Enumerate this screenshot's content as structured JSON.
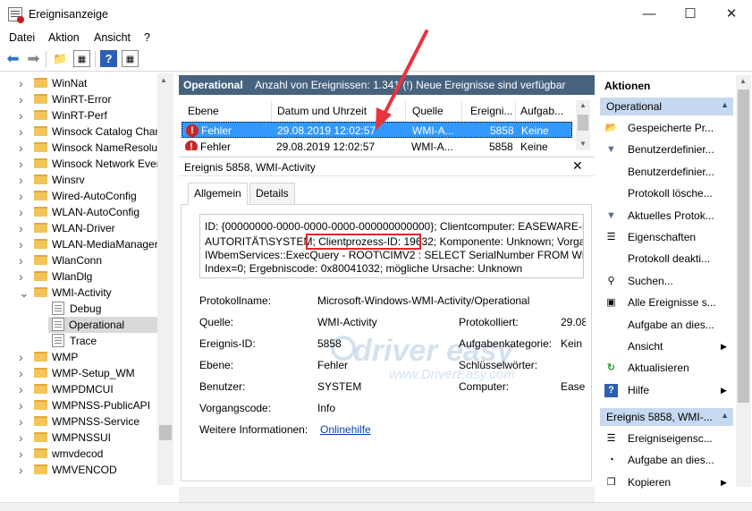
{
  "window": {
    "title": "Ereignisanzeige"
  },
  "menu": [
    "Datei",
    "Aktion",
    "Ansicht",
    "?"
  ],
  "tree": [
    {
      "label": "WinNat",
      "kind": "folder",
      "expanded": false
    },
    {
      "label": "WinRT-Error",
      "kind": "folder",
      "expanded": false
    },
    {
      "label": "WinRT-Perf",
      "kind": "folder",
      "expanded": false
    },
    {
      "label": "Winsock Catalog Chan",
      "kind": "folder",
      "expanded": false
    },
    {
      "label": "Winsock NameResolut",
      "kind": "folder",
      "expanded": false
    },
    {
      "label": "Winsock Network Ever",
      "kind": "folder",
      "expanded": false
    },
    {
      "label": "Winsrv",
      "kind": "folder",
      "expanded": false
    },
    {
      "label": "Wired-AutoConfig",
      "kind": "folder",
      "expanded": false
    },
    {
      "label": "WLAN-AutoConfig",
      "kind": "folder",
      "expanded": false
    },
    {
      "label": "WLAN-Driver",
      "kind": "folder",
      "expanded": false
    },
    {
      "label": "WLAN-MediaManager",
      "kind": "folder",
      "expanded": false
    },
    {
      "label": "WlanConn",
      "kind": "folder",
      "expanded": false
    },
    {
      "label": "WlanDlg",
      "kind": "folder",
      "expanded": false
    },
    {
      "label": "WMI-Activity",
      "kind": "folder",
      "expanded": true
    },
    {
      "label": "Debug",
      "kind": "log",
      "child": true
    },
    {
      "label": "Operational",
      "kind": "log",
      "child": true,
      "selected": true
    },
    {
      "label": "Trace",
      "kind": "log",
      "child": true
    },
    {
      "label": "WMP",
      "kind": "folder",
      "expanded": false
    },
    {
      "label": "WMP-Setup_WM",
      "kind": "folder",
      "expanded": false
    },
    {
      "label": "WMPDMCUI",
      "kind": "folder",
      "expanded": false
    },
    {
      "label": "WMPNSS-PublicAPI",
      "kind": "folder",
      "expanded": false
    },
    {
      "label": "WMPNSS-Service",
      "kind": "folder",
      "expanded": false
    },
    {
      "label": "WMPNSSUI",
      "kind": "folder",
      "expanded": false
    },
    {
      "label": "wmvdecod",
      "kind": "folder",
      "expanded": false
    },
    {
      "label": "WMVENCOD",
      "kind": "folder",
      "expanded": false
    }
  ],
  "events": {
    "header_title": "Operational",
    "header_info": "Anzahl von Ereignissen: 1.341 (!) Neue Ereignisse sind verfügbar",
    "columns": [
      "Ebene",
      "Datum und Uhrzeit",
      "Quelle",
      "Ereigni...",
      "Aufgab..."
    ],
    "rows": [
      [
        "Fehler",
        "29.08.2019 12:02:57",
        "WMI-A...",
        "5858",
        "Keine"
      ],
      [
        "Fehler",
        "29.08.2019 12:02:57",
        "WMI-A...",
        "5858",
        "Keine"
      ]
    ]
  },
  "detail": {
    "title": "Ereignis 5858, WMI-Activity",
    "tabs": [
      "Allgemein",
      "Details"
    ],
    "description": [
      "ID: {00000000-0000-0000-0000-000000000000}; Clientcomputer: EASEWARE-DELL",
      "AUTORITÄT\\SYSTEM; ",
      "Clientprozess-ID: 19632",
      "; Komponente: Unknown; Vorgang",
      "IWbemServices::ExecQuery - ROOT\\CIMV2 : SELECT SerialNumber FROM Win32_",
      "Index=0; Ergebniscode: 0x80041032; mögliche Ursache: Unknown"
    ],
    "props": {
      "protokollname_label": "Protokollname:",
      "protokollname": "Microsoft-Windows-WMI-Activity/Operational",
      "quelle_label": "Quelle:",
      "quelle": "WMI-Activity",
      "protokolliert_label": "Protokolliert:",
      "protokolliert": "29.08",
      "ereignis_label": "Ereignis-ID:",
      "ereignis": "5858",
      "kategorie_label": "Aufgabenkategorie:",
      "kategorie": "Kein",
      "ebene_label": "Ebene:",
      "ebene": "Fehler",
      "keywords_label": "Schlüsselwörter:",
      "keywords": "",
      "benutzer_label": "Benutzer:",
      "benutzer": "SYSTEM",
      "computer_label": "Computer:",
      "computer": "Ease",
      "opcode_label": "Vorgangscode:",
      "opcode": "Info",
      "info_label": "Weitere Informationen:",
      "info_link": "Onlinehilfe"
    }
  },
  "watermark": {
    "text": "driver easy",
    "sub": "www.DriverEasy.com"
  },
  "actions": {
    "header": "Aktionen",
    "section1": "Operational",
    "items1": [
      {
        "label": "Gespeicherte Pr...",
        "icon": "folder-open-icon",
        "glyph": "📂"
      },
      {
        "label": "Benutzerdefinier...",
        "icon": "filter-icon",
        "glyph": "▼"
      },
      {
        "label": "Benutzerdefinier...",
        "icon": "",
        "glyph": ""
      },
      {
        "label": "Protokoll lösche...",
        "icon": "",
        "glyph": ""
      },
      {
        "label": "Aktuelles Protok...",
        "icon": "filter-icon",
        "glyph": "▼"
      },
      {
        "label": "Eigenschaften",
        "icon": "properties-icon",
        "glyph": "☰"
      },
      {
        "label": "Protokoll deakti...",
        "icon": "",
        "glyph": ""
      },
      {
        "label": "Suchen...",
        "icon": "binoculars-icon",
        "glyph": "⚲"
      },
      {
        "label": "Alle Ereignisse s...",
        "icon": "save-icon",
        "glyph": "▣"
      },
      {
        "label": "Aufgabe an dies...",
        "icon": "",
        "glyph": ""
      },
      {
        "label": "Ansicht",
        "icon": "",
        "glyph": "",
        "submenu": true
      },
      {
        "label": "Aktualisieren",
        "icon": "refresh-icon",
        "glyph": "↻"
      },
      {
        "label": "Hilfe",
        "icon": "help-icon",
        "glyph": "?",
        "submenu": true
      }
    ],
    "section2": "Ereignis 5858, WMI-...",
    "items2": [
      {
        "label": "Ereigniseigensc...",
        "icon": "properties-icon",
        "glyph": "☰"
      },
      {
        "label": "Aufgabe an dies...",
        "icon": "task-icon",
        "glyph": "◔"
      },
      {
        "label": "Kopieren",
        "icon": "copy-icon",
        "glyph": "❐",
        "submenu": true
      }
    ]
  },
  "colors": {
    "header": "#47627f",
    "selection": "#3399ff",
    "section": "#c6d9f0",
    "annotation": "#e2262b"
  }
}
